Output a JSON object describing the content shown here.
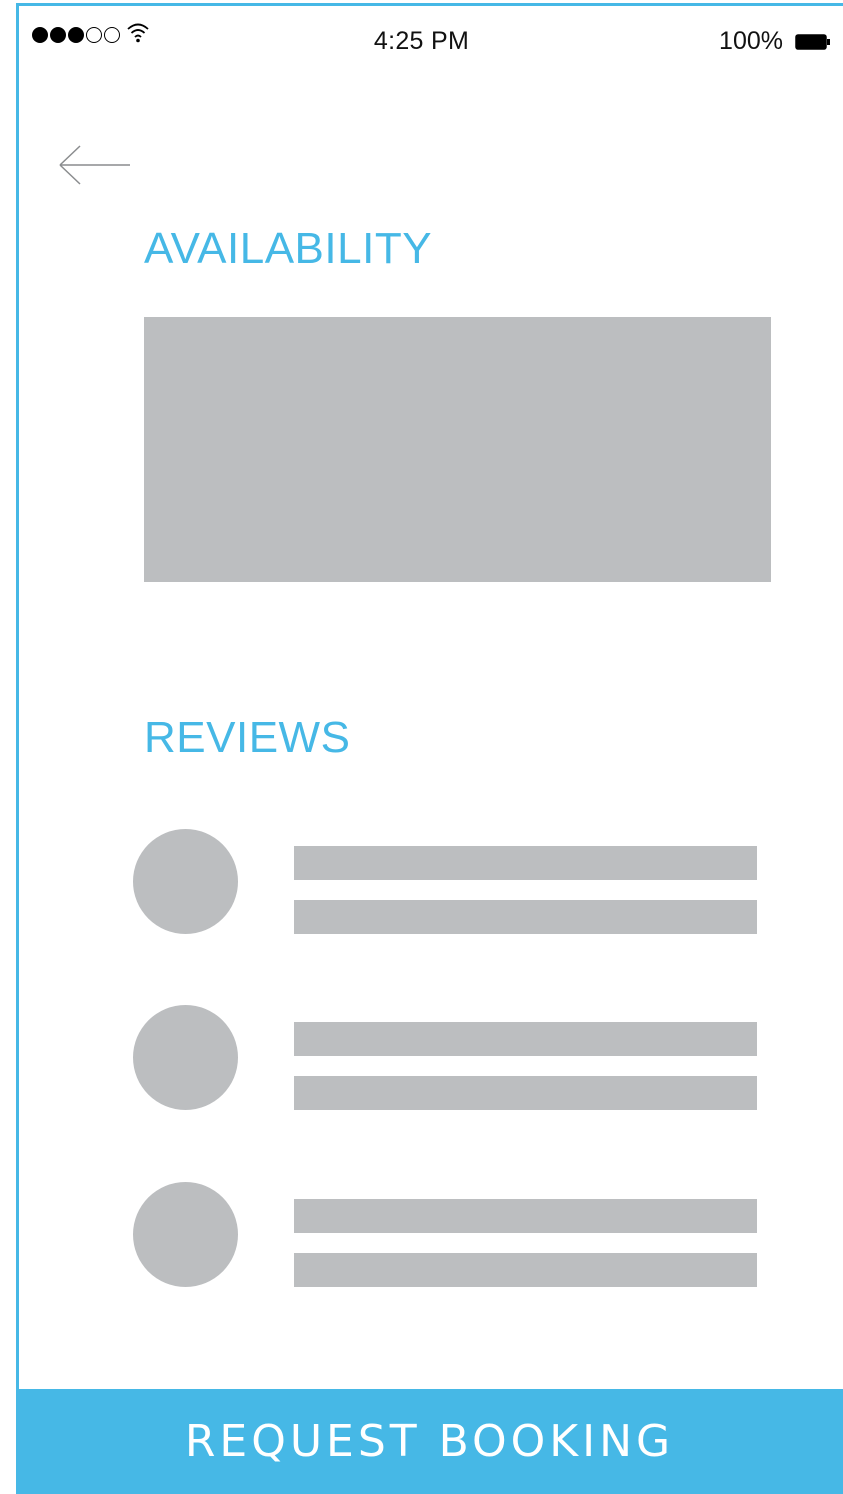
{
  "status_bar": {
    "signal_filled": 3,
    "signal_total": 5,
    "wifi_icon": "wifi-icon",
    "time": "4:25 PM",
    "battery_label": "100%",
    "battery_icon": "battery-icon"
  },
  "nav": {
    "back_icon": "arrow-left-icon"
  },
  "availability": {
    "title": "AVAILABILITY",
    "placeholder": "image-placeholder"
  },
  "reviews": {
    "title": "REVIEWS",
    "items": [
      {
        "avatar": "avatar-placeholder",
        "lines": 2
      },
      {
        "avatar": "avatar-placeholder",
        "lines": 2
      },
      {
        "avatar": "avatar-placeholder",
        "lines": 2
      }
    ]
  },
  "footer": {
    "button_label": "REQUEST BOOKING"
  },
  "colors": {
    "accent": "#46b8e6",
    "placeholder": "#bcbec0",
    "background": "#ffffff",
    "text": "#111111"
  }
}
